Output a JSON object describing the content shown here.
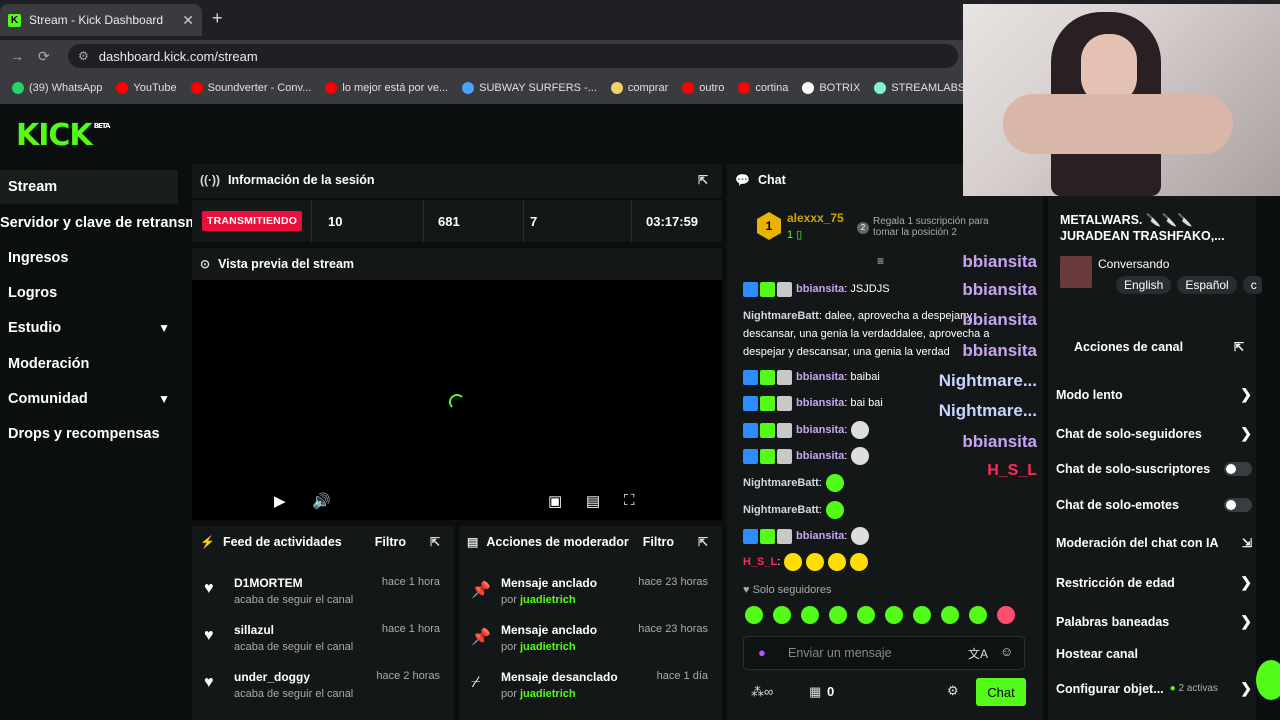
{
  "browser": {
    "tab_title": "Stream - Kick Dashboard",
    "url": "dashboard.kick.com/stream",
    "bookmarks": [
      {
        "label": "(39) WhatsApp",
        "color": "#25d366"
      },
      {
        "label": "YouTube",
        "color": "#ff0000"
      },
      {
        "label": "Soundverter - Conv...",
        "color": "#ff0000"
      },
      {
        "label": "lo mejor está por ve...",
        "color": "#ff0000"
      },
      {
        "label": "SUBWAY SURFERS -...",
        "color": "#4aa3ff"
      },
      {
        "label": "comprar",
        "color": "#f2d06b"
      },
      {
        "label": "outro",
        "color": "#ff0000"
      },
      {
        "label": "cortina",
        "color": "#ff0000"
      },
      {
        "label": "BOTRIX",
        "color": "#ffffff"
      },
      {
        "label": "STREAMLABS",
        "color": "#80f5d2"
      }
    ]
  },
  "brand": {
    "logo": "KICK",
    "beta": "BETA",
    "accent": "#53fc18"
  },
  "sidebar": {
    "items": [
      {
        "label": "Stream"
      },
      {
        "label": "Servidor y clave de retransm"
      },
      {
        "label": "Ingresos"
      },
      {
        "label": "Logros"
      },
      {
        "label": "Estudio"
      },
      {
        "label": "Moderación"
      },
      {
        "label": "Comunidad"
      },
      {
        "label": "Drops y recompensas"
      }
    ]
  },
  "session": {
    "title": "Información de la sesión",
    "status": "TRANSMITIENDO",
    "stats": [
      "10",
      "681",
      "7",
      "03:17:59"
    ]
  },
  "preview": {
    "title": "Vista previa del stream"
  },
  "activity": {
    "title": "Feed de actividades",
    "filter": "Filtro",
    "items": [
      {
        "user": "D1MORTEM",
        "action": "acaba de seguir el canal",
        "time": "hace 1 hora"
      },
      {
        "user": "sillazul",
        "action": "acaba de seguir el canal",
        "time": "hace 1 hora"
      },
      {
        "user": "under_doggy",
        "action": "acaba de seguir el canal",
        "time": "hace 2 horas"
      }
    ]
  },
  "modactions": {
    "title": "Acciones de moderador",
    "filter": "Filtro",
    "items": [
      {
        "action": "Mensaje anclado",
        "by": "por",
        "mod": "juadietrich",
        "time": "hace 23 horas"
      },
      {
        "action": "Mensaje anclado",
        "by": "por",
        "mod": "juadietrich",
        "time": "hace 23 horas"
      },
      {
        "action": "Mensaje desanclado",
        "by": "por",
        "mod": "juadietrich",
        "time": "hace 1 día"
      }
    ]
  },
  "chat": {
    "title": "Chat",
    "top_gifter": {
      "name": "alexxx_75",
      "count": "1",
      "rank": "1",
      "promo_rank": "2",
      "promo": "Regala 1 suscripción para tomar la posición 2"
    },
    "messages": [
      {
        "user": "bbiansita",
        "text": ": JSJDJS"
      },
      {
        "user": "NightmareBatt",
        "text": ": dalee, aprovecha a despejar y"
      },
      {
        "user": "",
        "text": "descansar, una genia la verdaddalee, aprovecha a"
      },
      {
        "user": "",
        "text": "despejar y descansar, una genia la verdad"
      },
      {
        "user": "bbiansita",
        "text": ": baibai"
      },
      {
        "user": "bbiansita",
        "text": ": bai bai"
      },
      {
        "user": "bbiansita",
        "text": ":"
      },
      {
        "user": "bbiansita",
        "text": ":"
      },
      {
        "user": "NightmareBatt",
        "text": ":"
      },
      {
        "user": "NightmareBatt",
        "text": ":"
      },
      {
        "user": "bbiansita",
        "text": ":"
      },
      {
        "user": "H_S_L",
        "text": ":"
      }
    ],
    "followers_only": "Solo seguidores",
    "input_placeholder": "Enviar un mensaje",
    "viewer_count": "0",
    "send_label": "Chat",
    "overlay": {
      "names": [
        "bbiansita",
        "bbiansita",
        "bbiansita",
        "bbiansita",
        "Nightmare...",
        "Nightmare...",
        "bbiansita",
        "H_S_L"
      ],
      "bai": "bai bai",
      "hi": "hi hi hi hi"
    }
  },
  "rightpanel": {
    "stream_title": "METALWARS. 🔪🔪🔪 JURADEAN TRASHFAKO,...",
    "category": "Conversando",
    "tags": [
      "English",
      "Español",
      "c"
    ],
    "actions_title": "Acciones de canal",
    "items": [
      {
        "label": "Modo lento"
      },
      {
        "label": "Chat de solo-seguidores"
      },
      {
        "label": "Chat de solo-suscriptores"
      },
      {
        "label": "Chat de solo-emotes"
      },
      {
        "label": "Moderación del chat con IA"
      },
      {
        "label": "Restricción de edad"
      },
      {
        "label": "Palabras baneadas"
      },
      {
        "label": "Hostear canal"
      },
      {
        "label": "Configurar objet..."
      }
    ],
    "active_count": "2 activas"
  }
}
